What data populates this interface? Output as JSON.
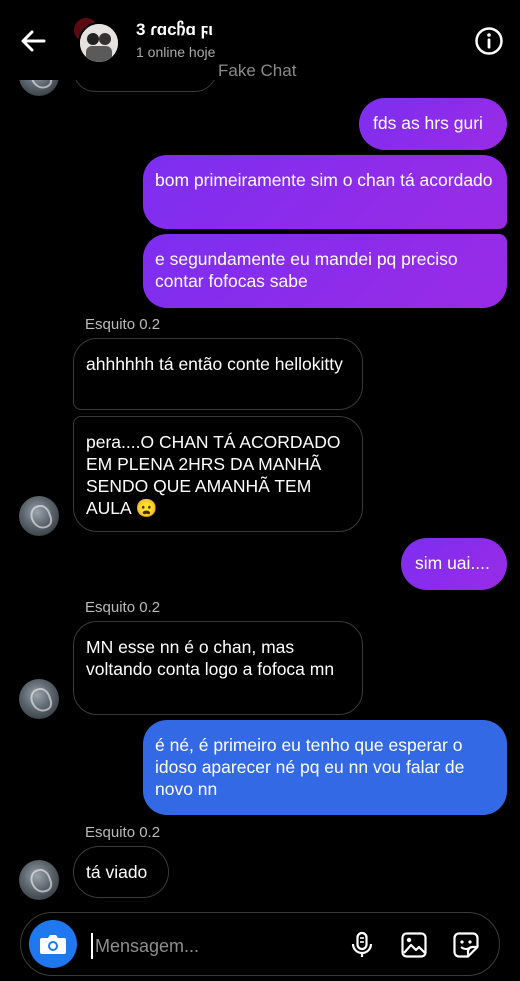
{
  "header": {
    "title": "3 ɾɑϲჩɑ ϝι",
    "subtitle": "1 online hoje",
    "watermark": "Fake Chat"
  },
  "messages": [
    {
      "text": "fds as hrs guri"
    },
    {
      "text": "bom primeiramente sim o chan tá acordado"
    },
    {
      "text": "e segundamente eu mandei pq preciso contar fofocas sabe"
    },
    {
      "sender": "Esquito 0.2"
    },
    {
      "text": "ahhhhhh tá então conte hellokitty"
    },
    {
      "text": "pera....O CHAN TÁ ACORDADO EM PLENA 2HRS DA MANHÃ SENDO QUE AMANHÃ TEM AULA 😦"
    },
    {
      "text": "sim uai...."
    },
    {
      "sender": "Esquito 0.2"
    },
    {
      "text": "MN esse nn é o chan, mas voltando conta logo a fofoca mn"
    },
    {
      "text": "é né, é primeiro eu tenho que esperar o idoso aparecer né pq eu nn vou falar de novo nn"
    },
    {
      "sender": "Esquito 0.2"
    },
    {
      "text": "tá viado"
    }
  ],
  "composer": {
    "placeholder": "Mensagem..."
  },
  "colors": {
    "sent_purple": "#8a2be2",
    "sent_blue": "#3469e6",
    "camera": "#1f78f0"
  }
}
